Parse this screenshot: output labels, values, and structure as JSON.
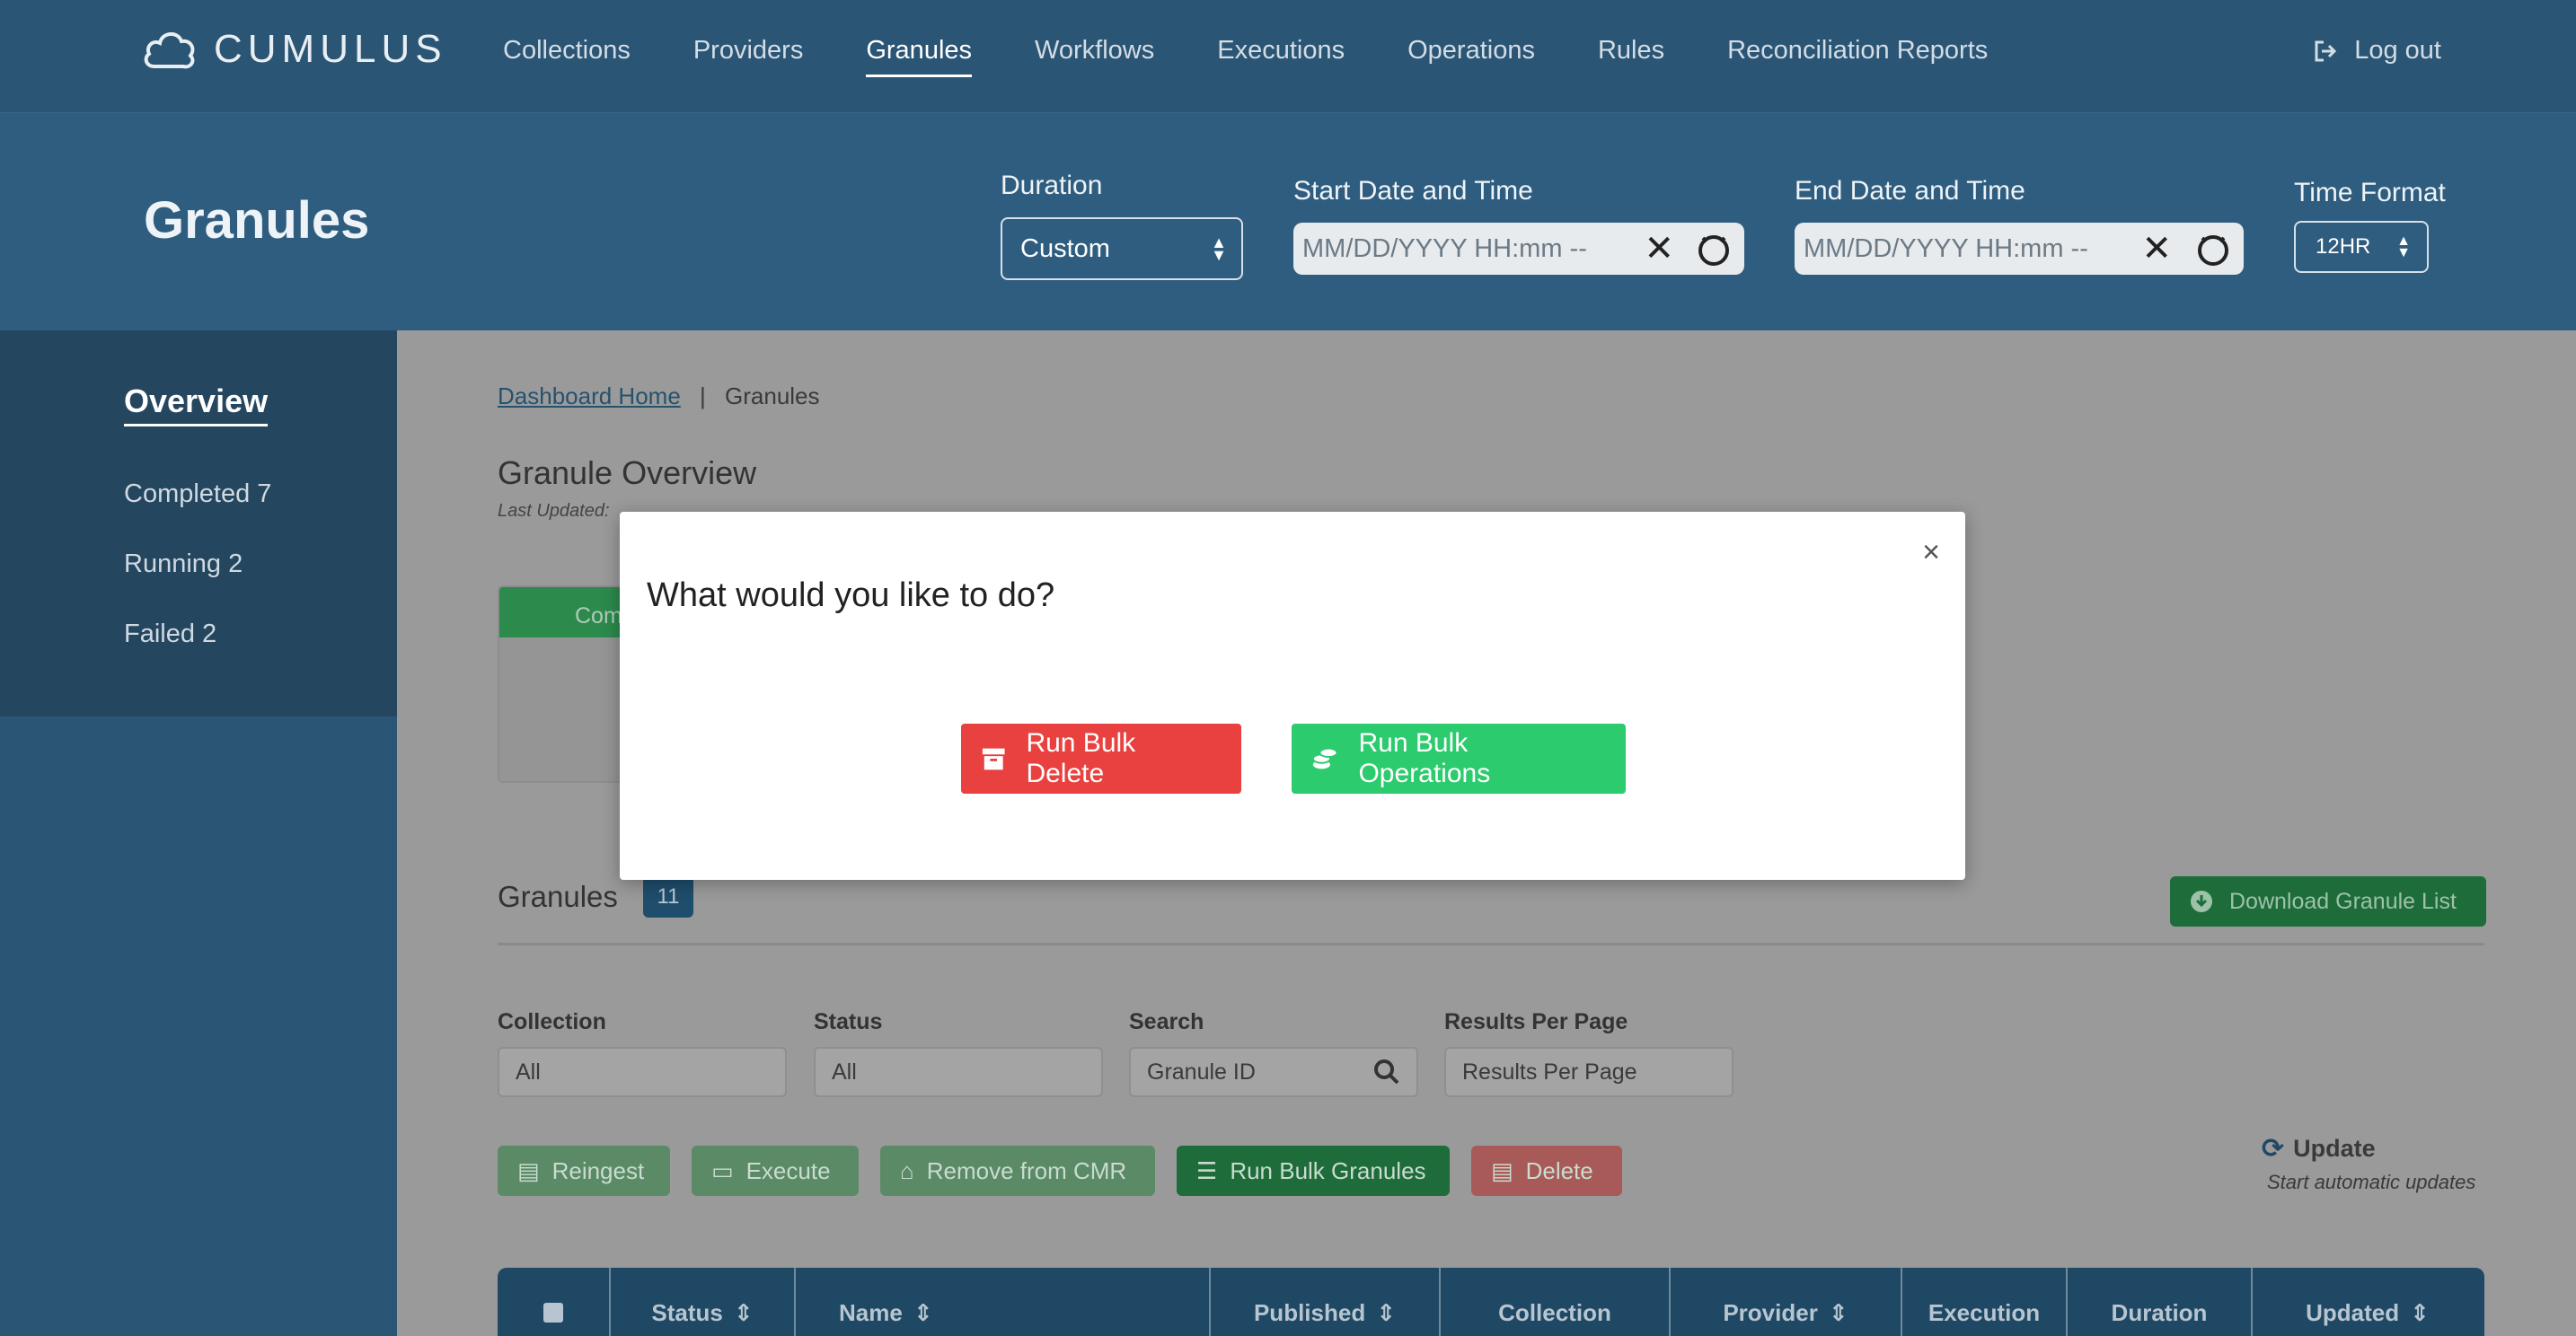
{
  "app": {
    "name": "CUMULUS"
  },
  "nav": {
    "items": [
      "Collections",
      "Providers",
      "Granules",
      "Workflows",
      "Executions",
      "Operations",
      "Rules",
      "Reconciliation Reports"
    ],
    "active": "Granules",
    "logout": "Log out"
  },
  "header": {
    "title": "Granules",
    "duration": {
      "label": "Duration",
      "value": "Custom"
    },
    "start": {
      "label": "Start Date and Time",
      "placeholder": "MM/DD/YYYY HH:mm --"
    },
    "end": {
      "label": "End Date and Time",
      "placeholder": "MM/DD/YYYY HH:mm --"
    },
    "time_format": {
      "label": "Time Format",
      "value": "12HR"
    }
  },
  "sidebar": {
    "title": "Overview",
    "items": [
      "Completed 7",
      "Running 2",
      "Failed 2"
    ]
  },
  "breadcrumb": {
    "home": "Dashboard Home",
    "sep": "|",
    "current": "Granules"
  },
  "overview": {
    "title": "Granule Overview",
    "last_updated": "Last Updated:",
    "card_label": "Com"
  },
  "granules": {
    "title": "Granules",
    "count": "11",
    "download": "Download Granule List"
  },
  "filters": {
    "collection": {
      "label": "Collection",
      "value": "All"
    },
    "status": {
      "label": "Status",
      "value": "All"
    },
    "search": {
      "label": "Search",
      "placeholder": "Granule ID"
    },
    "per_page": {
      "label": "Results Per Page",
      "placeholder": "Results Per Page"
    }
  },
  "actions": [
    "Reingest",
    "Execute",
    "Remove from CMR",
    "Run Bulk Granules",
    "Delete"
  ],
  "update": {
    "label": "Update",
    "sub": "Start automatic updates"
  },
  "table": {
    "columns": [
      "Status",
      "Name",
      "Published",
      "Collection",
      "Provider",
      "Execution",
      "Duration",
      "Updated"
    ]
  },
  "modal": {
    "title": "What would you like to do?",
    "close": "×",
    "delete_label": "Run Bulk Delete",
    "bulk_label": "Run Bulk Operations"
  },
  "colors": {
    "nav": "#2b5574",
    "header": "#2f5d7f",
    "danger": "#e9413f",
    "success": "#2ccb6d"
  }
}
